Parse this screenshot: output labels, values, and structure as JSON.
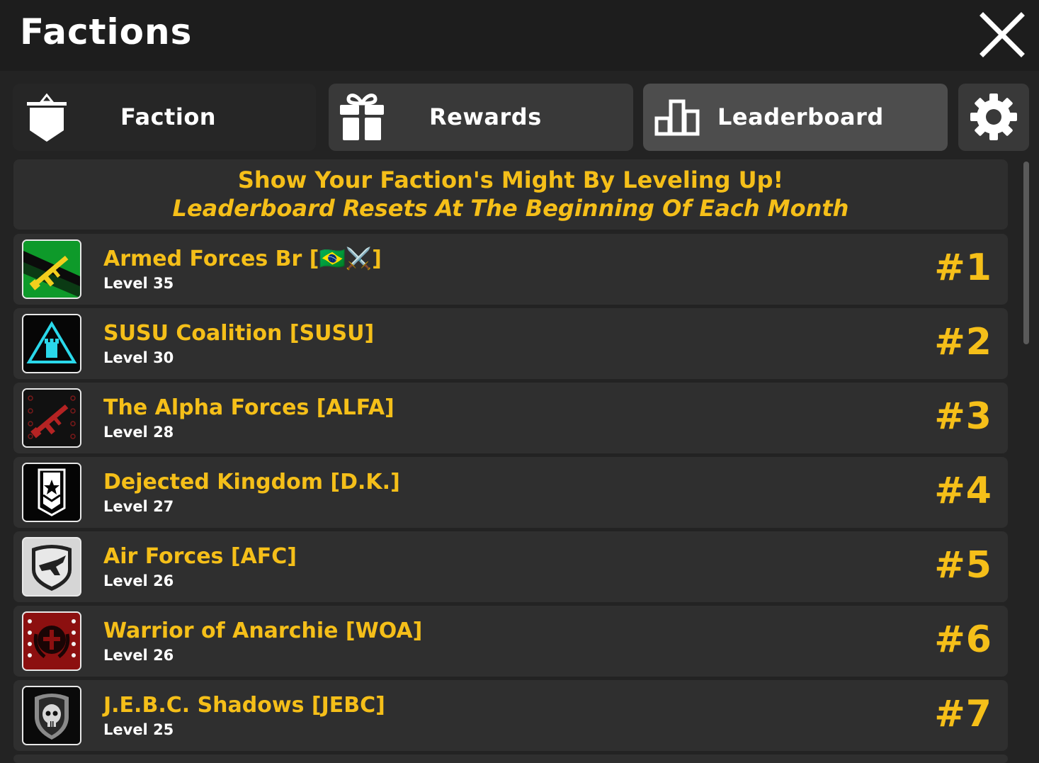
{
  "window": {
    "title": "Factions"
  },
  "tabs": [
    {
      "id": "faction",
      "label": "Faction",
      "icon": "shield-banner-icon"
    },
    {
      "id": "rewards",
      "label": "Rewards",
      "icon": "gift-icon"
    },
    {
      "id": "leaderboard",
      "label": "Leaderboard",
      "icon": "bar-chart-icon",
      "selected": true
    },
    {
      "id": "settings",
      "icon": "gear-icon"
    }
  ],
  "banner": {
    "line1": "Show Your Faction's Might By Leveling Up!",
    "line2": "Leaderboard Resets At The Beginning Of Each Month"
  },
  "leaderboard": [
    {
      "name": "Armed Forces Br [🇧🇷⚔️]",
      "level": "Level 35",
      "rank": "#1",
      "emblem": "rifle-green-emblem"
    },
    {
      "name": "SUSU Coalition [SUSU]",
      "level": "Level 30",
      "rank": "#2",
      "emblem": "tower-triangle-emblem"
    },
    {
      "name": "The Alpha Forces [ALFA]",
      "level": "Level 28",
      "rank": "#3",
      "emblem": "red-rifle-emblem"
    },
    {
      "name": "Dejected Kingdom [D.K.]",
      "level": "Level 27",
      "rank": "#4",
      "emblem": "star-banner-emblem"
    },
    {
      "name": "Air Forces [AFC]",
      "level": "Level 26",
      "rank": "#5",
      "emblem": "jet-shield-emblem"
    },
    {
      "name": "Warrior of Anarchie [WOA]",
      "level": "Level 26",
      "rank": "#6",
      "emblem": "skull-wreath-emblem"
    },
    {
      "name": "J.E.B.C. Shadows [JEBC]",
      "level": "Level 25",
      "rank": "#7",
      "emblem": "skull-shield-emblem"
    }
  ],
  "colors": {
    "accent": "#f5bf19",
    "background": "#232323",
    "row": "#2f2f2f",
    "tab_selected": "#4d4d4d"
  }
}
